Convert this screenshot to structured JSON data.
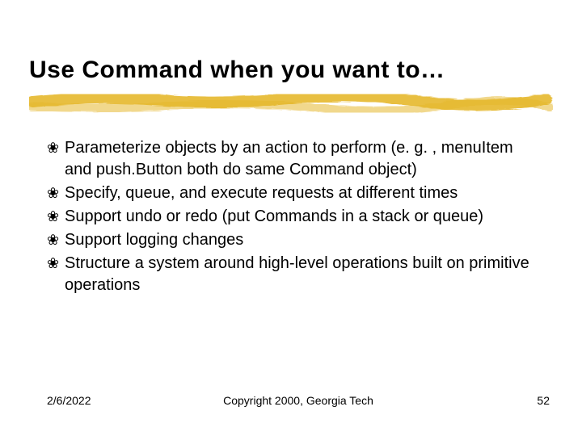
{
  "title": "Use Command when you want to…",
  "bullets": [
    "Parameterize objects by an action to perform (e. g. , menuItem and push.Button both do same Command object)",
    "Specify, queue, and execute requests at different times",
    "Support undo or redo (put Commands in a stack or queue)",
    "Support logging changes",
    "Structure a system around high-level operations built on primitive operations"
  ],
  "footer": {
    "date": "2/6/2022",
    "copyright": "Copyright 2000, Georgia Tech",
    "page": "52"
  },
  "bullet_glyph": "❀",
  "underline_color": "#e6b82e"
}
